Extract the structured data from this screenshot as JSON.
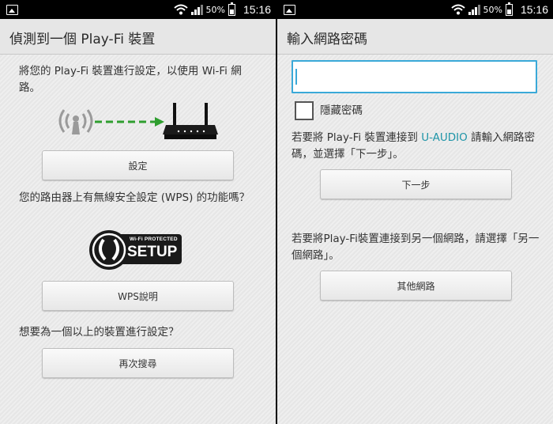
{
  "status_bar": {
    "battery_pct": "50%",
    "time": "15:16",
    "icons": [
      "image-icon",
      "wifi-icon",
      "signal-icon",
      "battery-icon"
    ]
  },
  "left": {
    "title": "偵測到一個 Play-Fi 裝置",
    "intro": "將您的 Play-Fi 裝置進行設定，以使用 Wi-Fi 網路。",
    "setup_button": "設定",
    "wps_question": "您的路由器上有無線安全設定 (WPS) 的功能嗎？",
    "wps_logo_line1": "Wi-Fi PROTECTED",
    "wps_logo_line2": "SETUP",
    "wps_help_button": "WPS說明",
    "multi_question": "想要為一個以上的裝置進行設定？",
    "search_again_button": "再次搜尋",
    "illustration_icons": [
      "wifi-signal-icon",
      "arrow-right-icon",
      "router-icon"
    ]
  },
  "right": {
    "title": "輸入網路密碼",
    "password_value": "",
    "hide_password_label": "隱藏密碼",
    "connect_text_before": "若要將 Play-Fi 裝置連接到 ",
    "network_name": "U-AUDIO",
    "connect_text_after": " 請輸入網路密碼，並選擇「下一步」。",
    "next_button": "下一步",
    "other_text": "若要將Play-Fi裝置連接到另一個網路，請選擇「另一個網路」。",
    "other_network_button": "其他網路"
  },
  "colors": {
    "accent": "#1f95a8",
    "field_border": "#3aa9d8",
    "background": "#ebebeb",
    "title_bar": "#e6e6e6",
    "arrow_green": "#2f9e2f"
  }
}
